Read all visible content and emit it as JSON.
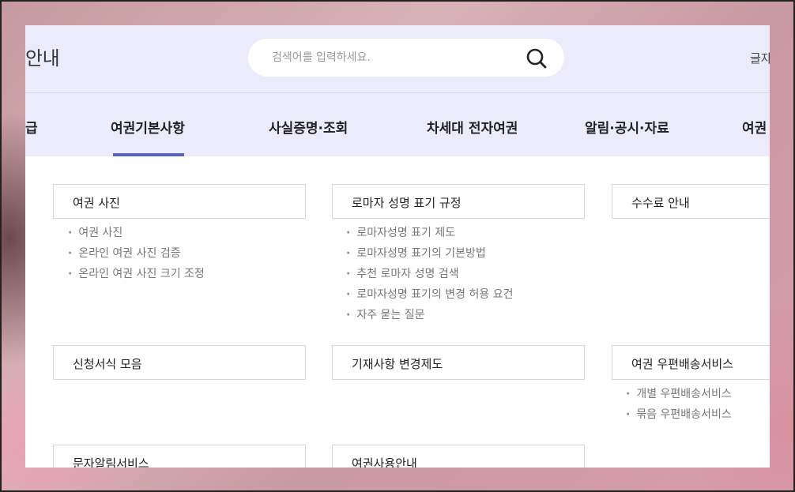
{
  "header": {
    "site_title": "안내",
    "search_placeholder": "검색어를 입력하세요.",
    "font_size_label": "글자"
  },
  "nav": {
    "items": [
      "급",
      "여권기본사항",
      "사실증명·조회",
      "차세대 전자여권",
      "알림·공시·자료",
      "여권"
    ],
    "active": "여권기본사항"
  },
  "sections": [
    {
      "title": "여권 사진",
      "items": [
        "여권 사진",
        "온라인 여권 사진 검증",
        "온라인 여권 사진 크기 조정"
      ]
    },
    {
      "title": "로마자 성명 표기 규정",
      "items": [
        "로마자성명 표기 제도",
        "로마자성명 표기의 기본방법",
        "추천 로마자 성명 검색",
        "로마자성명 표기의 변경 허용 요건",
        "자주 묻는 질문"
      ]
    },
    {
      "title": "수수료 안내",
      "items": []
    },
    {
      "title": "신청서식 모음",
      "items": []
    },
    {
      "title": "기재사항 변경제도",
      "items": []
    },
    {
      "title": "여권 우편배송서비스",
      "items": [
        "개별 우편배송서비스",
        "묶음 우편배송서비스"
      ]
    },
    {
      "title": "문자알림서비스",
      "items": []
    },
    {
      "title": "여권사용안내",
      "items": []
    }
  ],
  "colors": {
    "header_bg": "#ebebfb",
    "accent": "#5a63b8"
  }
}
